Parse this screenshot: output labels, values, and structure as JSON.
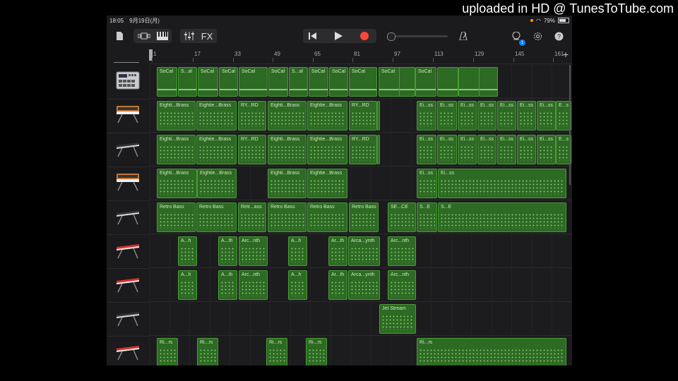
{
  "watermark": "uploaded in HD @ TunesToTube.com",
  "status": {
    "time": "18:05",
    "date": "9月19日(月)",
    "battery": "79%",
    "battery_level": 0.79
  },
  "toolbar": {
    "fx_label": "FX",
    "notification_count": "1"
  },
  "ruler": {
    "bars": [
      "1",
      "17",
      "33",
      "49",
      "65",
      "81",
      "97",
      "113",
      "129",
      "145",
      "161"
    ],
    "add_label": "+"
  },
  "tracks": [
    {
      "name": "drum-machine",
      "regions": [
        {
          "label": "SoCal"
        },
        {
          "label": "S...al"
        },
        {
          "label": "SoCal"
        },
        {
          "label": "SoCal"
        },
        {
          "label": "SoCal"
        },
        {
          "label": "SoCal"
        },
        {
          "label": "S...al"
        },
        {
          "label": "SoCal"
        },
        {
          "label": "SoCal"
        },
        {
          "label": "SoCal"
        },
        {
          "label": "SoCal"
        },
        {
          "label": ""
        },
        {
          "label": "SoCal"
        },
        {
          "label": ""
        },
        {
          "label": ""
        },
        {
          "label": ""
        }
      ]
    },
    {
      "name": "synth-orange-1",
      "regions": [
        {
          "label": "Eighti...Brass"
        },
        {
          "label": "Eightie...Brass"
        },
        {
          "label": "RY...RD"
        },
        {
          "label": "Eighti...Brass"
        },
        {
          "label": "Eightie...Brass"
        },
        {
          "label": "RY...RD"
        },
        {
          "label": ""
        },
        {
          "label": "Ei...ss"
        },
        {
          "label": "Ei...ss"
        },
        {
          "label": "Ei...ss"
        },
        {
          "label": "Ei...ss"
        },
        {
          "label": "Ei...ss"
        },
        {
          "label": "Ei...ss"
        },
        {
          "label": "Ei...ss"
        },
        {
          "label": "E...s"
        }
      ]
    },
    {
      "name": "synth-black-1",
      "regions": [
        {
          "label": "Eighti...Brass"
        },
        {
          "label": "Eightie...Brass"
        },
        {
          "label": "RY...RD"
        },
        {
          "label": "Eighti...Brass"
        },
        {
          "label": "Eightie...Brass"
        },
        {
          "label": "RY...RD"
        },
        {
          "label": ""
        },
        {
          "label": "Ei...ss"
        },
        {
          "label": "Ei...ss"
        },
        {
          "label": "Ei...ss"
        },
        {
          "label": "Ei...ss"
        },
        {
          "label": "Ei...ss"
        },
        {
          "label": "Ei...ss"
        },
        {
          "label": "Ei...ss"
        },
        {
          "label": "E...s"
        }
      ]
    },
    {
      "name": "synth-orange-2",
      "regions": [
        {
          "label": "Eighti...Brass"
        },
        {
          "label": "Eightie...Brass"
        },
        {
          "label": "Eighti...Brass"
        },
        {
          "label": "Eightie...Brass"
        },
        {
          "label": "Ei...ss"
        },
        {
          "label": "Ei...ss"
        }
      ]
    },
    {
      "name": "synth-black-2",
      "regions": [
        {
          "label": "Retro Bass"
        },
        {
          "label": "Retro Bass"
        },
        {
          "label": "Retr...ass"
        },
        {
          "label": "Retro Bass"
        },
        {
          "label": "Retro Bass"
        },
        {
          "label": "Retro Bass"
        },
        {
          "label": "SE...CE"
        },
        {
          "label": "S...E"
        },
        {
          "label": "S...E"
        }
      ]
    },
    {
      "name": "synth-red-1",
      "regions": [
        {
          "label": "A...h"
        },
        {
          "label": "A...th"
        },
        {
          "label": "Arc...nth"
        },
        {
          "label": "A...h"
        },
        {
          "label": "Ar...th"
        },
        {
          "label": "Arca...ynth"
        },
        {
          "label": "Arc...nth"
        }
      ]
    },
    {
      "name": "synth-red-2",
      "regions": [
        {
          "label": "A...h"
        },
        {
          "label": "A...th"
        },
        {
          "label": "Arc...nth"
        },
        {
          "label": "A...h"
        },
        {
          "label": "Ar...th"
        },
        {
          "label": "Arca...ynth"
        },
        {
          "label": "Arc...nth"
        }
      ]
    },
    {
      "name": "synth-black-3",
      "regions": [
        {
          "label": "Jet Stream"
        }
      ]
    },
    {
      "name": "synth-red-3",
      "regions": [
        {
          "label": "Ri...rs"
        },
        {
          "label": "Ri...rs"
        },
        {
          "label": "Ri...rs"
        },
        {
          "label": "Ri...rs"
        },
        {
          "label": "Ri...rs"
        }
      ]
    }
  ],
  "colors": {
    "region": "#2d6a23",
    "region_border": "#4a9a3a",
    "notes": "#9fe08a",
    "record": "#ff453a",
    "accent": "#0a84ff"
  },
  "icons": [
    "document-icon",
    "tracks-view-icon",
    "keyboard-icon",
    "mixer-icon",
    "rewind-icon",
    "play-icon",
    "record-icon",
    "metronome-icon",
    "notifications-icon",
    "settings-icon",
    "help-icon"
  ]
}
